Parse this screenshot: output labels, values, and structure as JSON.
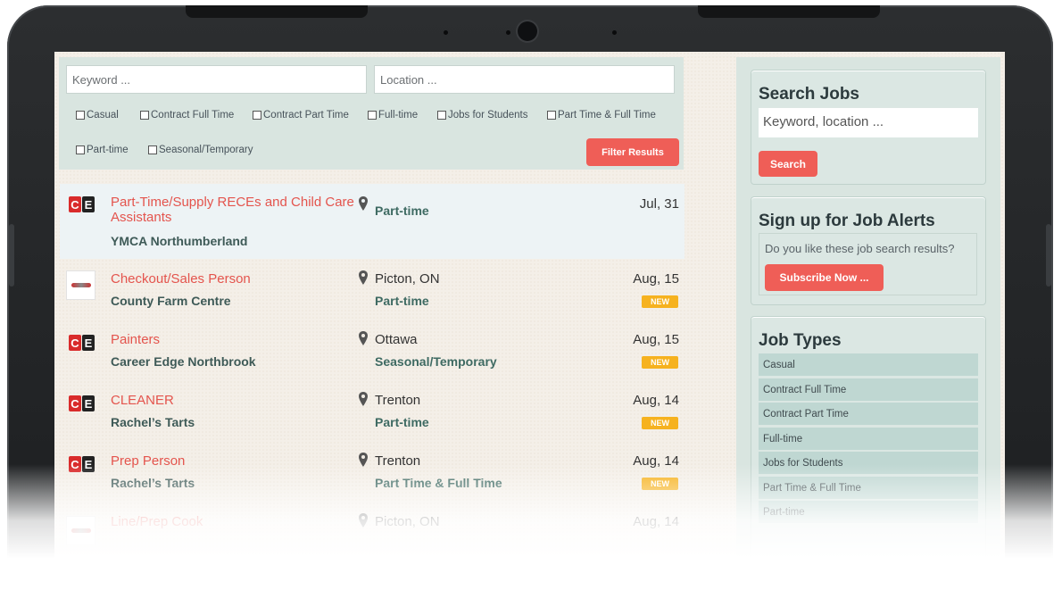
{
  "search": {
    "keyword_placeholder": "Keyword ...",
    "location_placeholder": "Location ...",
    "filter_button": "Filter Results"
  },
  "filters": [
    {
      "label": "Casual",
      "checked": false
    },
    {
      "label": "Contract Full Time",
      "checked": false
    },
    {
      "label": "Contract Part Time",
      "checked": false
    },
    {
      "label": "Full-time",
      "checked": false
    },
    {
      "label": "Jobs for Students",
      "checked": false
    },
    {
      "label": "Part Time & Full Time",
      "checked": false
    },
    {
      "label": "Part-time",
      "checked": false
    },
    {
      "label": "Seasonal/Temporary",
      "checked": false
    }
  ],
  "jobs": [
    {
      "logo": "career-edge-logo",
      "title": "Part-Time/Supply RECEs and Child Care Assistants",
      "company": "YMCA Northumberland",
      "location": "",
      "type": "Part-time",
      "date": "Jul, 31",
      "badge": ""
    },
    {
      "logo": "county-farm-logo",
      "title": "Checkout/Sales Person",
      "company": "County Farm Centre",
      "location": "Picton, ON",
      "type": "Part-time",
      "date": "Aug, 15",
      "badge": "NEW"
    },
    {
      "logo": "career-edge-logo",
      "title": "Painters",
      "company": "Career Edge Northbrook",
      "location": "Ottawa",
      "type": "Seasonal/Temporary",
      "date": "Aug, 15",
      "badge": "NEW"
    },
    {
      "logo": "career-edge-logo",
      "title": "CLEANER",
      "company": "Rachel’s Tarts",
      "location": "Trenton",
      "type": "Part-time",
      "date": "Aug, 14",
      "badge": "NEW"
    },
    {
      "logo": "career-edge-logo",
      "title": "Prep Person",
      "company": "Rachel’s Tarts",
      "location": "Trenton",
      "type": "Part Time & Full Time",
      "date": "Aug, 14",
      "badge": "NEW"
    },
    {
      "logo": "county-farm-logo",
      "title": "Line/Prep Cook",
      "company": "",
      "location": "Picton, ON",
      "type": "",
      "date": "Aug, 14",
      "badge": ""
    }
  ],
  "sidebar": {
    "search": {
      "title": "Search Jobs",
      "placeholder": "Keyword, location ...",
      "button": "Search"
    },
    "alerts": {
      "title": "Sign up for Job Alerts",
      "text": "Do you like these job search results?",
      "button": "Subscribe Now ..."
    },
    "job_types": {
      "title": "Job Types",
      "items": [
        "Casual",
        "Contract Full Time",
        "Contract Part Time",
        "Full-time",
        "Jobs for Students",
        "Part Time & Full Time",
        "Part-time"
      ]
    }
  },
  "colors": {
    "accent": "#ef5e57",
    "badge": "#f6b21f",
    "panel": "#d9e5e0",
    "link": "#e4544d"
  }
}
